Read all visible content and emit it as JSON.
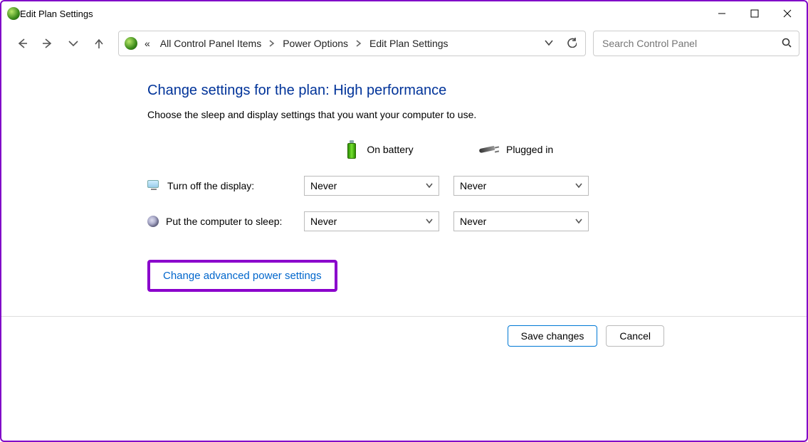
{
  "window": {
    "title": "Edit Plan Settings"
  },
  "breadcrumb": {
    "prefix": "«",
    "items": [
      "All Control Panel Items",
      "Power Options",
      "Edit Plan Settings"
    ]
  },
  "search": {
    "placeholder": "Search Control Panel"
  },
  "page": {
    "heading": "Change settings for the plan: High performance",
    "subtext": "Choose the sleep and display settings that you want your computer to use.",
    "col_battery": "On battery",
    "col_plugged": "Plugged in",
    "rows": {
      "display": {
        "label": "Turn off the display:",
        "battery": "Never",
        "plugged": "Never"
      },
      "sleep": {
        "label": "Put the computer to sleep:",
        "battery": "Never",
        "plugged": "Never"
      }
    },
    "advanced_link": "Change advanced power settings"
  },
  "footer": {
    "save": "Save changes",
    "cancel": "Cancel"
  }
}
